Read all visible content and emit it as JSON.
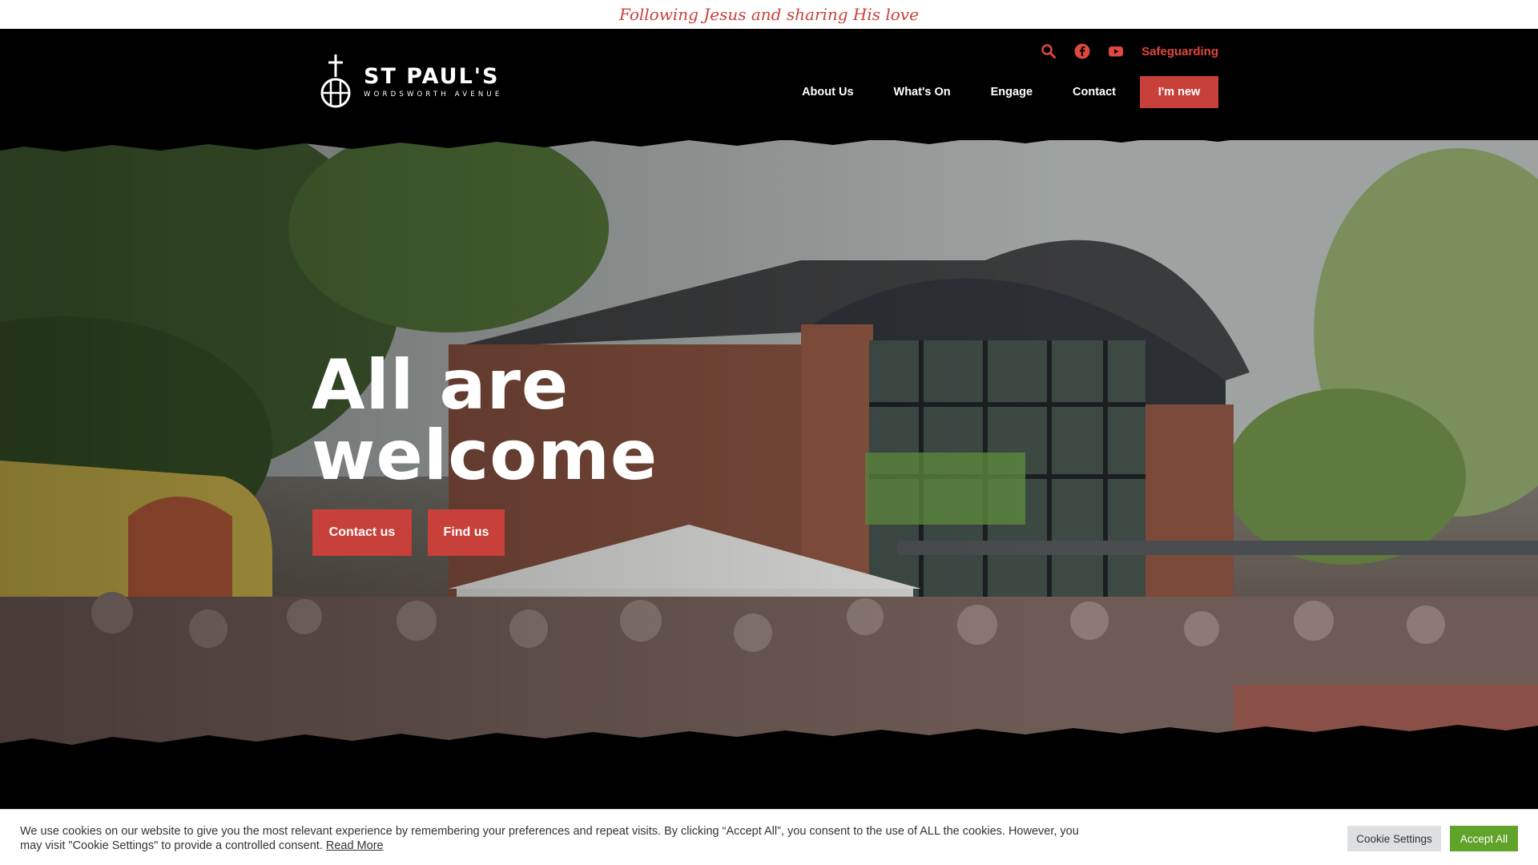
{
  "topbar": {
    "tagline": "Following Jesus and sharing His love"
  },
  "header": {
    "logo": {
      "title": "ST PAUL'S",
      "subtitle": "WORDSWORTH AVENUE"
    },
    "utility": {
      "safeguarding_label": "Safeguarding",
      "icons": [
        "search-icon",
        "facebook-icon",
        "youtube-icon"
      ]
    },
    "nav": {
      "items": [
        {
          "label": "About Us"
        },
        {
          "label": "What's On"
        },
        {
          "label": "Engage"
        },
        {
          "label": "Contact"
        }
      ],
      "cta_label": "I'm new"
    }
  },
  "hero": {
    "title_line1": "All are",
    "title_line2": "welcome",
    "buttons": [
      {
        "label": "Contact us"
      },
      {
        "label": "Find us"
      }
    ]
  },
  "cookie_banner": {
    "text": "We use cookies on our website to give you the most relevant experience by remembering your preferences and repeat visits. By clicking “Accept All”, you consent to the use of ALL the cookies. However, you may visit \"Cookie Settings\" to provide a controlled consent.",
    "read_more": "Read More",
    "settings_label": "Cookie Settings",
    "accept_label": "Accept All"
  },
  "colors": {
    "accent": "#c8403a",
    "accept_green": "#61a229",
    "header_bg": "#000000"
  }
}
